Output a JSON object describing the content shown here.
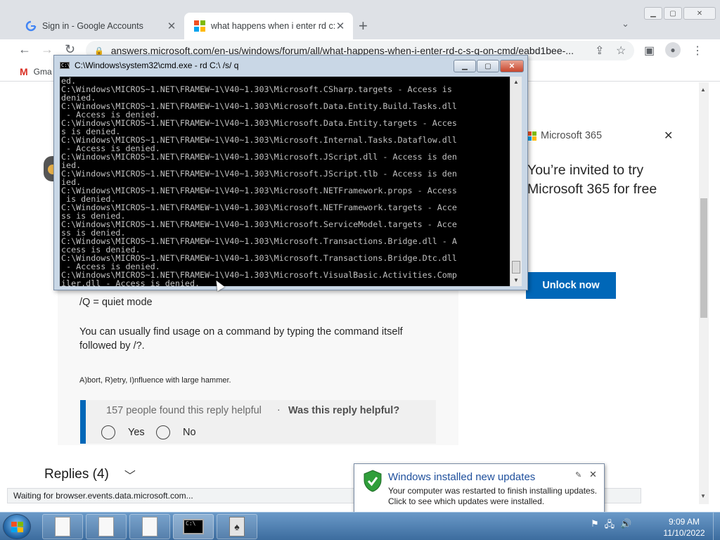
{
  "browser": {
    "tabs": [
      {
        "title": "Sign in - Google Accounts",
        "close": "✕"
      },
      {
        "title": "what happens when i enter rd c:\\",
        "close": "✕"
      }
    ],
    "new_tab": "+",
    "url": "answers.microsoft.com/en-us/windows/forum/all/what-happens-when-i-enter-rd-c-s-q-on-cmd/eabd1bee-...",
    "bookmarks": [
      {
        "label": "Gma"
      }
    ],
    "status_text": "Waiting for browser.events.data.microsoft.com..."
  },
  "page": {
    "quiet_mode": "/Q = quiet mode",
    "usage_text": "You can usually find usage on a command by typing the command itself followed by /?.",
    "signature": "A)bort, R)etry, I)nfluence with large hammer.",
    "helpful_count": "157 people found this reply helpful",
    "helpful_question": "Was this reply helpful?",
    "yes_label": "Yes",
    "no_label": "No",
    "replies_label": "Replies (4)"
  },
  "promo": {
    "brand": "Microsoft 365",
    "headline": "You’re invited to try Microsoft 365 for free",
    "button": "Unlock now",
    "colors": {
      "red": "#f25022",
      "green": "#7fba00",
      "blue": "#00a4ef",
      "yellow": "#ffb900"
    }
  },
  "cmd": {
    "title": "C:\\Windows\\system32\\cmd.exe - rd  C:\\ /s/ q",
    "icon_text": "C:\\",
    "console_text": "ed.\nC:\\Windows\\MICROS~1.NET\\FRAMEW~1\\V40~1.303\\Microsoft.CSharp.targets - Access is\ndenied.\nC:\\Windows\\MICROS~1.NET\\FRAMEW~1\\V40~1.303\\Microsoft.Data.Entity.Build.Tasks.dll\n - Access is denied.\nC:\\Windows\\MICROS~1.NET\\FRAMEW~1\\V40~1.303\\Microsoft.Data.Entity.targets - Acces\ns is denied.\nC:\\Windows\\MICROS~1.NET\\FRAMEW~1\\V40~1.303\\Microsoft.Internal.Tasks.Dataflow.dll\n - Access is denied.\nC:\\Windows\\MICROS~1.NET\\FRAMEW~1\\V40~1.303\\Microsoft.JScript.dll - Access is den\nied.\nC:\\Windows\\MICROS~1.NET\\FRAMEW~1\\V40~1.303\\Microsoft.JScript.tlb - Access is den\nied.\nC:\\Windows\\MICROS~1.NET\\FRAMEW~1\\V40~1.303\\Microsoft.NETFramework.props - Access\n is denied.\nC:\\Windows\\MICROS~1.NET\\FRAMEW~1\\V40~1.303\\Microsoft.NETFramework.targets - Acce\nss is denied.\nC:\\Windows\\MICROS~1.NET\\FRAMEW~1\\V40~1.303\\Microsoft.ServiceModel.targets - Acce\nss is denied.\nC:\\Windows\\MICROS~1.NET\\FRAMEW~1\\V40~1.303\\Microsoft.Transactions.Bridge.dll - A\nccess is denied.\nC:\\Windows\\MICROS~1.NET\\FRAMEW~1\\V40~1.303\\Microsoft.Transactions.Bridge.Dtc.dll\n - Access is denied.\nC:\\Windows\\MICROS~1.NET\\FRAMEW~1\\V40~1.303\\Microsoft.VisualBasic.Activities.Comp\niler.dll - Access is denied."
  },
  "notification": {
    "title": "Windows installed new updates",
    "line1": "Your computer was restarted to finish installing updates.",
    "line2": "Click to see which updates were installed."
  },
  "taskbar": {
    "time": "9:09 AM",
    "date": "11/10/2022",
    "cmd_icon_text": "C:\\",
    "solitaire_glyph": "♠"
  }
}
